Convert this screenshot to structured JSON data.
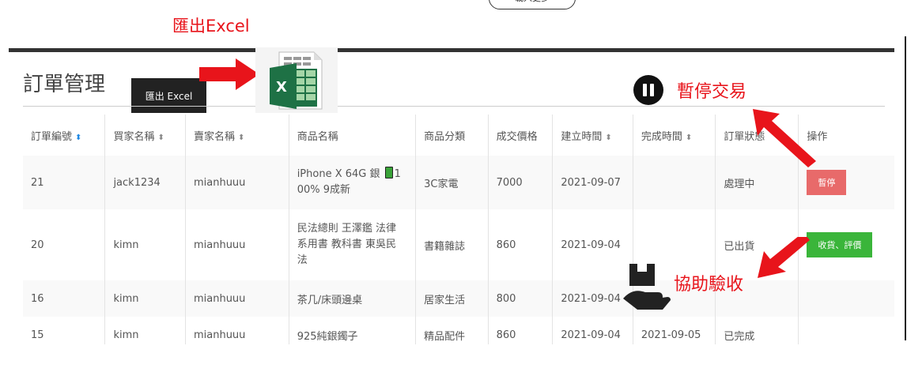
{
  "top_button": {
    "label": "載入更多"
  },
  "annotations": {
    "export": "匯出Excel",
    "pause": "暫停交易",
    "inspect": "協助驗收"
  },
  "page": {
    "title": "訂單管理",
    "export_button": "匯出 Excel"
  },
  "table": {
    "headers": [
      "訂單編號",
      "買家名稱",
      "賣家名稱",
      "商品名稱",
      "商品分類",
      "成交價格",
      "建立時間",
      "完成時間",
      "訂單狀態",
      "操作"
    ],
    "rows": [
      {
        "id": "21",
        "buyer": "jack1234",
        "seller": "mianhuuu",
        "product": "iPhone X 64G 銀 🔋100% 9成新",
        "product_a": "iPhone X 64G 銀 ",
        "product_b": "1",
        "product_c": "00% 9成新",
        "category": "3C家電",
        "price": "7000",
        "created": "2021-09-07",
        "completed": "",
        "status": "處理中",
        "action": "暫停"
      },
      {
        "id": "20",
        "buyer": "kimn",
        "seller": "mianhuuu",
        "product": "民法總則 王澤鑑 法律系用書 教科書 東吳民法",
        "product_l1": "民法總則 王澤鑑 法律",
        "product_l2": "系用書 教科書 東吳民",
        "product_l3": "法",
        "category": "書籍雜誌",
        "price": "860",
        "created": "2021-09-04",
        "completed": "",
        "status": "已出貨",
        "action": "收貨、評價"
      },
      {
        "id": "16",
        "buyer": "kimn",
        "seller": "mianhuuu",
        "product": "茶几/床頭邊桌",
        "category": "居家生活",
        "price": "800",
        "created": "2021-09-04",
        "completed": "",
        "status": "",
        "action": ""
      },
      {
        "id": "15",
        "buyer": "kimn",
        "seller": "mianhuuu",
        "product": "925純銀鐲子",
        "category": "精品配件",
        "price": "860",
        "created": "2021-09-04",
        "completed": "2021-09-05",
        "status": "已完成",
        "action": ""
      }
    ]
  },
  "colors": {
    "annotation_red": "#e8141b",
    "pause_button": "#e86a6a",
    "receive_button": "#3ab53a",
    "excel_green": "#1e7145"
  },
  "icons": [
    "sort-asc-icon",
    "sort-icon",
    "excel-file-icon",
    "pause-circle-icon",
    "hand-box-icon",
    "red-arrow-icon"
  ]
}
